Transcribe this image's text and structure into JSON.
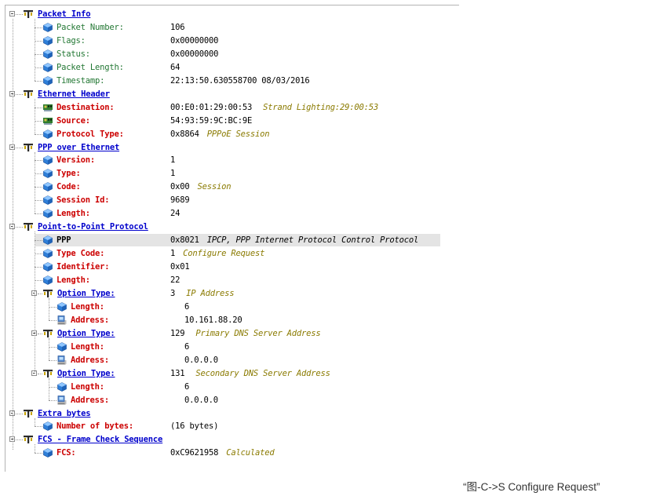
{
  "sections": [
    {
      "id": "packet-info",
      "title": "Packet Info",
      "fields": [
        {
          "label": "Packet Number:",
          "value": "106",
          "style": "green",
          "icon": "field-icon"
        },
        {
          "label": "Flags:",
          "value": "0x00000000",
          "style": "green",
          "icon": "field-icon"
        },
        {
          "label": "Status:",
          "value": "0x00000000",
          "style": "green",
          "icon": "field-icon"
        },
        {
          "label": "Packet Length:",
          "value": "64",
          "style": "green",
          "icon": "field-icon"
        },
        {
          "label": "Timestamp:",
          "value": "22:13:50.630558700 08/03/2016",
          "style": "green",
          "icon": "field-icon"
        }
      ]
    },
    {
      "id": "ethernet-header",
      "title": "Ethernet Header",
      "fields": [
        {
          "label": "Destination:",
          "value": "00:E0:01:29:00:53",
          "decode": "Strand Lighting:29:00:53",
          "style": "red",
          "icon": "network-card-icon",
          "wide": true
        },
        {
          "label": "Source:",
          "value": "54:93:59:9C:BC:9E",
          "style": "red",
          "icon": "network-card-icon"
        },
        {
          "label": "Protocol Type:",
          "value": "0x8864",
          "decode": "PPPoE Session",
          "style": "red",
          "icon": "field-icon"
        }
      ]
    },
    {
      "id": "ppp-over-ethernet",
      "title": "PPP over Ethernet",
      "fields": [
        {
          "label": "Version:",
          "value": "1",
          "style": "red",
          "icon": "field-icon"
        },
        {
          "label": "Type:",
          "value": "1",
          "style": "red",
          "icon": "field-icon"
        },
        {
          "label": "Code:",
          "value": "0x00",
          "decode": "Session",
          "style": "red",
          "icon": "field-icon"
        },
        {
          "label": "Session Id:",
          "value": "9689",
          "style": "red",
          "icon": "field-icon"
        },
        {
          "label": "Length:",
          "value": "24",
          "style": "red",
          "icon": "field-icon"
        }
      ]
    },
    {
      "id": "point-to-point-protocol",
      "title": "Point-to-Point Protocol",
      "fields": [
        {
          "label": "PPP",
          "value": "0x8021",
          "decode": "IPCP, PPP Internet Protocol Control Protocol",
          "style": "blk",
          "icon": "field-icon",
          "highlight": true,
          "decodeBlack": true
        },
        {
          "label": "Type Code:",
          "value": "1",
          "decode": "Configure Request",
          "style": "red",
          "icon": "field-icon"
        },
        {
          "label": "Identifier:",
          "value": "0x01",
          "style": "red",
          "icon": "field-icon"
        },
        {
          "label": "Length:",
          "value": "22",
          "style": "red",
          "icon": "field-icon"
        }
      ],
      "options": [
        {
          "title": "Option Type:",
          "value": "3",
          "decode": "IP Address",
          "fields": [
            {
              "label": "Length:",
              "value": "6",
              "style": "red",
              "icon": "field-icon"
            },
            {
              "label": "Address:",
              "value": "10.161.88.20",
              "style": "red",
              "icon": "computer-icon"
            }
          ]
        },
        {
          "title": "Option Type:",
          "value": "129",
          "decode": "Primary DNS Server Address",
          "fields": [
            {
              "label": "Length:",
              "value": "6",
              "style": "red",
              "icon": "field-icon"
            },
            {
              "label": "Address:",
              "value": "0.0.0.0",
              "style": "red",
              "icon": "computer-icon"
            }
          ]
        },
        {
          "title": "Option Type:",
          "value": "131",
          "decode": "Secondary DNS Server Address",
          "fields": [
            {
              "label": "Length:",
              "value": "6",
              "style": "red",
              "icon": "field-icon"
            },
            {
              "label": "Address:",
              "value": "0.0.0.0",
              "style": "red",
              "icon": "computer-icon"
            }
          ]
        }
      ]
    },
    {
      "id": "extra-bytes",
      "title": "Extra bytes",
      "fields": [
        {
          "label": "Number of bytes:",
          "value": "(16 bytes)",
          "style": "red",
          "icon": "field-icon"
        }
      ]
    },
    {
      "id": "fcs",
      "title": "FCS - Frame Check Sequence",
      "fields": [
        {
          "label": "FCS:",
          "value": "0xC9621958",
          "decode": "Calculated",
          "style": "red",
          "icon": "field-icon"
        }
      ]
    }
  ],
  "caption": "“图-C->S Configure Request”",
  "colors": {
    "header": "#0000cc",
    "field_red": "#cc0000",
    "field_green": "#227733",
    "decode": "#8a7a00",
    "highlight": "#e4e4e4"
  }
}
